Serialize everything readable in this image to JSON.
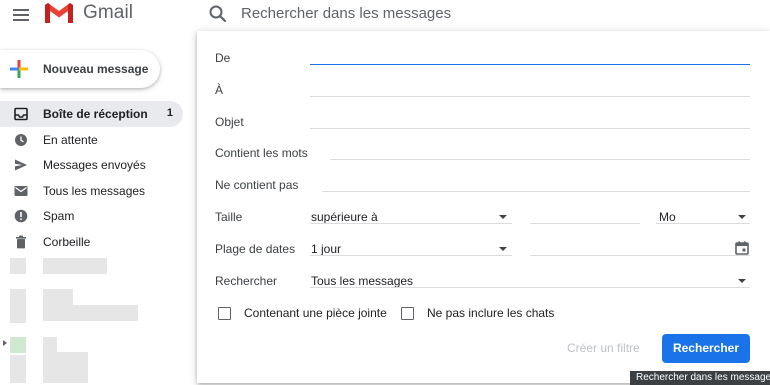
{
  "app": {
    "name": "Gmail"
  },
  "header": {
    "search_placeholder": "Rechercher dans les messages"
  },
  "compose": {
    "label": "Nouveau message"
  },
  "sidebar": {
    "items": [
      {
        "label": "Boîte de réception",
        "count": "1",
        "icon": "inbox-icon",
        "active": true
      },
      {
        "label": "En attente",
        "icon": "clock-icon"
      },
      {
        "label": "Messages envoyés",
        "icon": "send-icon"
      },
      {
        "label": "Tous les messages",
        "icon": "mail-icon"
      },
      {
        "label": "Spam",
        "icon": "spam-icon"
      },
      {
        "label": "Corbeille",
        "icon": "trash-icon"
      }
    ]
  },
  "search_panel": {
    "from_label": "De",
    "to_label": "À",
    "subject_label": "Objet",
    "has_words_label": "Contient les mots",
    "no_words_label": "Ne contient pas",
    "size_label": "Taille",
    "size_operator": "supérieure à",
    "size_unit": "Mo",
    "date_label": "Plage de dates",
    "date_range": "1 jour",
    "search_in_label": "Rechercher",
    "search_in_value": "Tous les messages",
    "has_attachment_label": "Contenant une pièce jointe",
    "exclude_chats_label": "Ne pas inclure les chats",
    "create_filter_label": "Créer un filtre",
    "search_button_label": "Rechercher"
  },
  "tooltip": {
    "text": "Rechercher dans les messages"
  },
  "colors": {
    "accent": "#1a73e8",
    "gmail_red": "#ea4335"
  }
}
